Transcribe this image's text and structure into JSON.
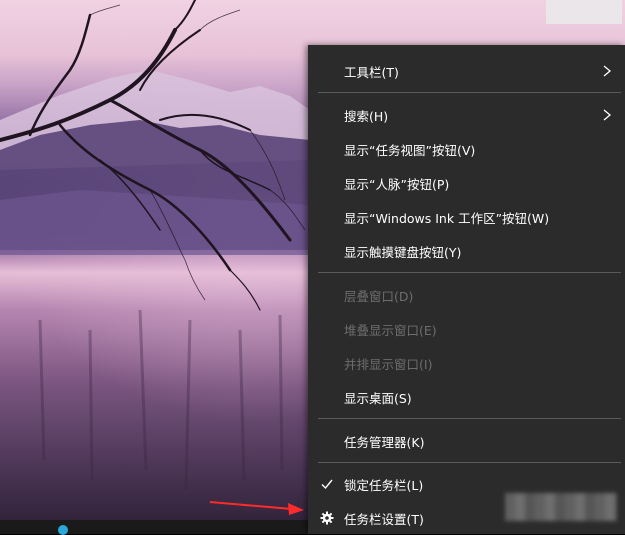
{
  "menu": {
    "items": [
      {
        "id": "toolbar",
        "label": "工具栏(T)",
        "submenu": true,
        "enabled": true
      },
      {
        "id": "search",
        "label": "搜索(H)",
        "submenu": true,
        "enabled": true
      },
      {
        "id": "task-view",
        "label": "显示“任务视图”按钮(V)",
        "enabled": true
      },
      {
        "id": "people",
        "label": "显示“人脉”按钮(P)",
        "enabled": true
      },
      {
        "id": "ink",
        "label": "显示“Windows Ink 工作区”按钮(W)",
        "enabled": true
      },
      {
        "id": "touch-keyboard",
        "label": "显示触摸键盘按钮(Y)",
        "enabled": true
      },
      {
        "id": "cascade",
        "label": "层叠窗口(D)",
        "enabled": false
      },
      {
        "id": "stack",
        "label": "堆叠显示窗口(E)",
        "enabled": false
      },
      {
        "id": "side-by-side",
        "label": "并排显示窗口(I)",
        "enabled": false
      },
      {
        "id": "show-desktop",
        "label": "显示桌面(S)",
        "enabled": true
      },
      {
        "id": "task-manager",
        "label": "任务管理器(K)",
        "enabled": true
      },
      {
        "id": "lock-taskbar",
        "label": "锁定任务栏(L)",
        "enabled": true,
        "checked": true
      },
      {
        "id": "taskbar-settings",
        "label": "任务栏设置(T)",
        "enabled": true,
        "icon": "gear-icon"
      }
    ]
  },
  "colors": {
    "menu_bg": "#2b2b2b",
    "menu_text": "#ffffff",
    "disabled_text": "#6d6d6d",
    "separator": "#5a5a5a",
    "annotation_arrow": "#ff2a2a"
  }
}
